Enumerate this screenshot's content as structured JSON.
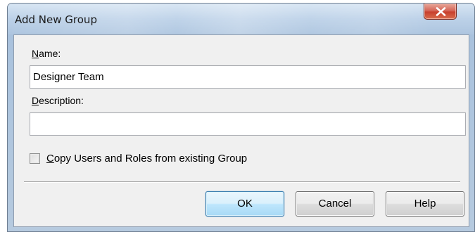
{
  "window": {
    "title": "Add New Group"
  },
  "form": {
    "name_label_accel": "N",
    "name_label_rest": "ame:",
    "name_value": "Designer Team",
    "description_label_accel": "D",
    "description_label_rest": "escription:",
    "description_value": "",
    "copy_checkbox_accel": "C",
    "copy_checkbox_rest": "opy Users and Roles from existing Group",
    "copy_checked": false
  },
  "buttons": {
    "ok": "OK",
    "cancel": "Cancel",
    "help": "Help"
  },
  "icons": {
    "close": "close-x-icon"
  }
}
